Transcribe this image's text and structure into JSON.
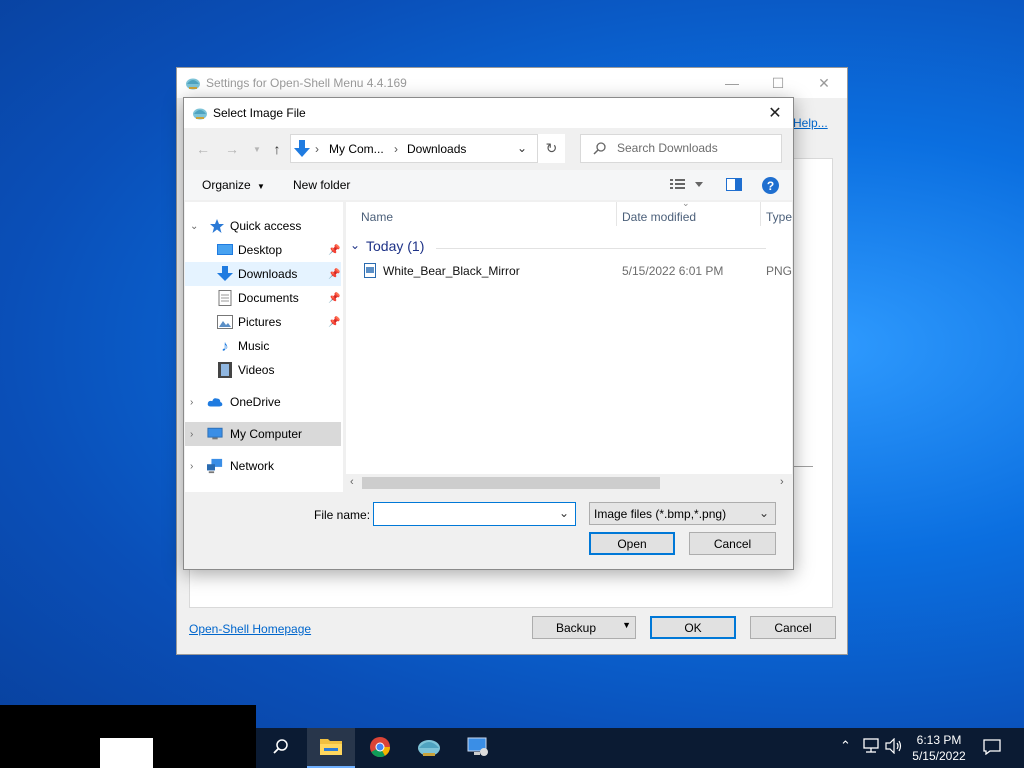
{
  "settings_window": {
    "title": "Settings for Open-Shell Menu 4.4.169",
    "minimize_glyph": "—",
    "maximize_glyph": "☐",
    "close_glyph": "✕",
    "help_link": "Help...",
    "homepage_link": "Open-Shell Homepage",
    "backup_label": "Backup",
    "ok_label": "OK",
    "cancel_label": "Cancel"
  },
  "dialog": {
    "title": "Select Image File",
    "close_glyph": "✕",
    "address": {
      "segment_1": "My Com...",
      "separator": "›",
      "segment_2": "Downloads"
    },
    "search_placeholder": "Search Downloads",
    "toolbar": {
      "organize": "Organize",
      "new_folder": "New folder",
      "help": "?"
    },
    "nav": {
      "quick_access": "Quick access",
      "desktop": "Desktop",
      "downloads": "Downloads",
      "documents": "Documents",
      "pictures": "Pictures",
      "music": "Music",
      "videos": "Videos",
      "onedrive": "OneDrive",
      "my_computer": "My Computer",
      "network": "Network"
    },
    "columns": {
      "name": "Name",
      "date_modified": "Date modified",
      "type": "Type"
    },
    "group_header": "Today (1)",
    "files": [
      {
        "name": "White_Bear_Black_Mirror",
        "date": "5/15/2022 6:01 PM",
        "type": "PNG"
      }
    ],
    "file_name_label": "File name:",
    "file_name_value": "",
    "file_type": "Image files (*.bmp,*.png)",
    "open_label": "Open",
    "cancel_label": "Cancel"
  },
  "taskbar": {
    "time": "6:13 PM",
    "date": "5/15/2022"
  }
}
